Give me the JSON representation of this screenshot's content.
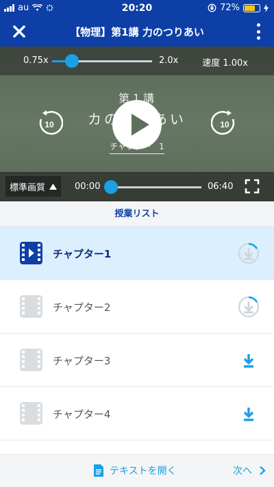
{
  "status_bar": {
    "carrier": "au",
    "time": "20:20",
    "battery_percent": "72%",
    "battery_color": "#f5c518"
  },
  "header": {
    "title": "【物理】第1講 力のつりあい",
    "background": "#0d3fa6"
  },
  "player": {
    "speed_min": "0.75x",
    "speed_max": "2.0x",
    "speed_label": "速度 1.00x",
    "speed_value": 1.0,
    "board_title": "第１講",
    "board_subtitle": "カのつりあい",
    "board_chapter": "チャプター　1",
    "skip_back_seconds": "10",
    "skip_forward_seconds": "10",
    "quality_label": "標準画質",
    "current_time": "00:00",
    "total_time": "06:40",
    "progress": 0
  },
  "lesson_list": {
    "title": "授業リスト",
    "items": [
      {
        "label": "チャプター1",
        "active": true,
        "download": "loading"
      },
      {
        "label": "チャプター2",
        "active": false,
        "download": "loading"
      },
      {
        "label": "チャプター3",
        "active": false,
        "download": "available"
      },
      {
        "label": "チャプター4",
        "active": false,
        "download": "available"
      }
    ]
  },
  "footer": {
    "open_text_label": "テキストを開く",
    "next_label": "次へ"
  },
  "colors": {
    "accent": "#1aa0e6",
    "brand": "#0d3fa6",
    "active_row": "#dcefff"
  },
  "icons": {
    "close": "close-icon",
    "more": "more-vertical-icon",
    "play": "play-icon",
    "skip_back": "replay-10-icon",
    "skip_forward": "forward-10-icon",
    "fullscreen": "fullscreen-icon",
    "download": "download-icon",
    "film": "film-icon",
    "document": "document-icon",
    "chevron_right": "chevron-right-icon"
  }
}
